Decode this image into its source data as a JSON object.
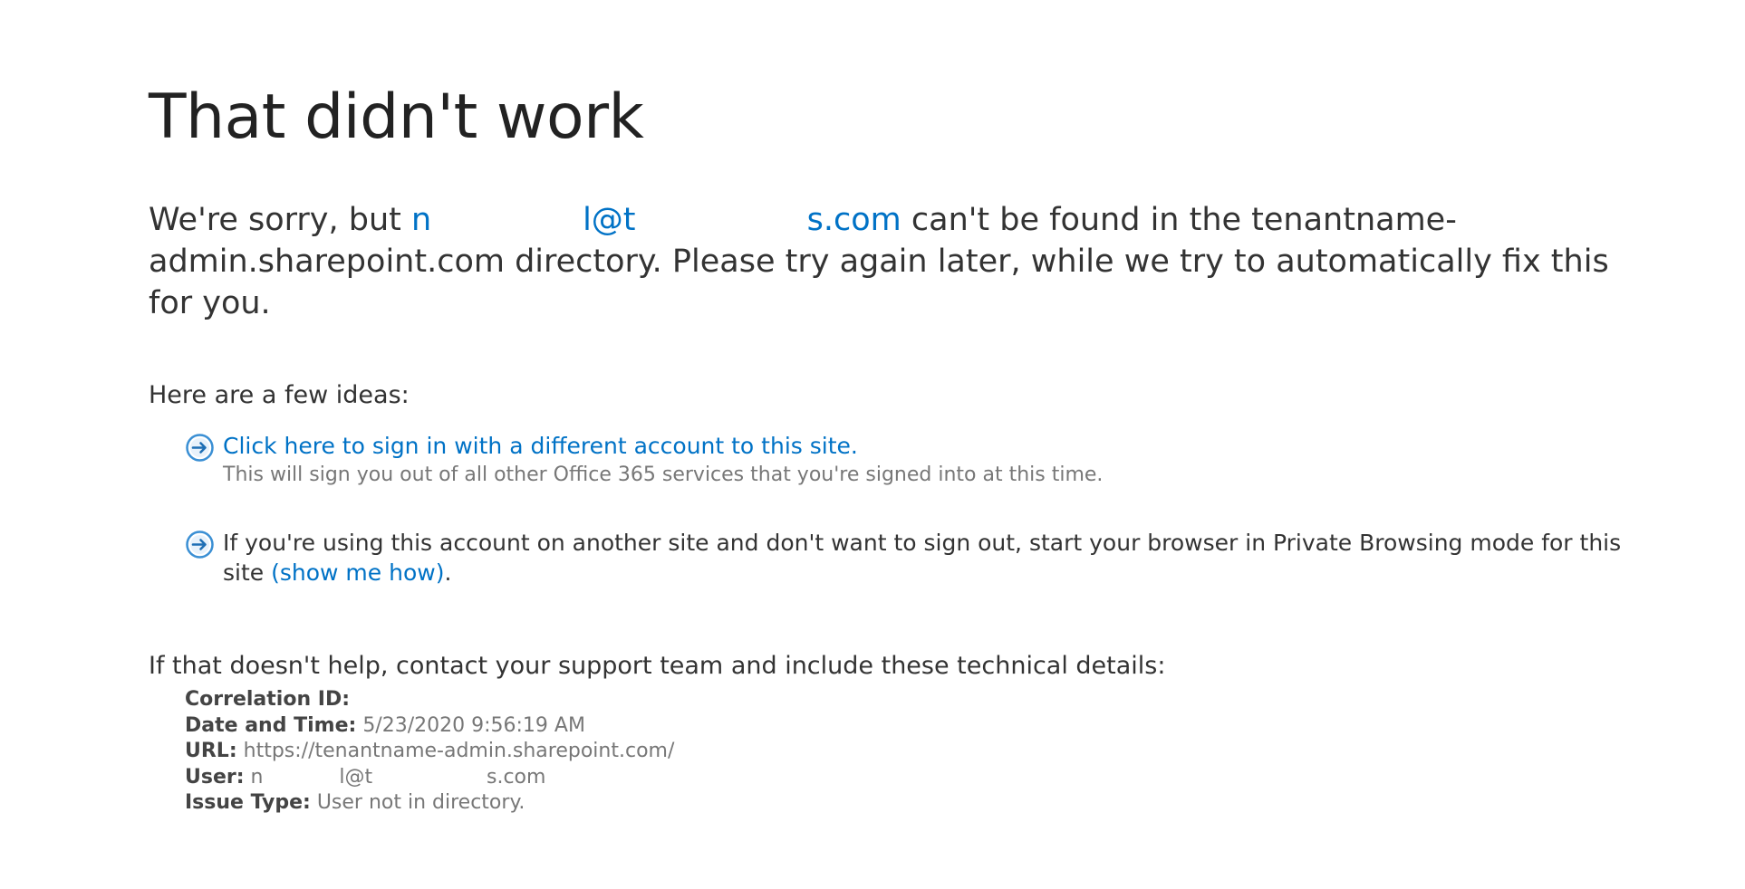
{
  "page": {
    "title": "That didn't work",
    "message": {
      "prefix": "We're sorry, but ",
      "email_display": "n               l@t                 s.com",
      "suffix": " can't be found in the tenantname-admin.sharepoint.com directory. Please try again later, while we try to automatically fix this for you."
    },
    "ideas_heading": "Here are a few ideas:",
    "ideas": [
      {
        "link_text": "Click here to sign in with a different account to this site.",
        "subtext": "This will sign you out of all other Office 365 services that you're signed into at this time.",
        "icon": "circle-arrow-right-icon"
      },
      {
        "text": "If you're using this account on another site and don't want to sign out, start your browser in Private Browsing mode for this site ",
        "link_text": "(show me how)",
        "trailing": ".",
        "icon": "circle-arrow-right-icon"
      }
    ],
    "help_text": "If that doesn't help, contact your support team and include these technical details:",
    "details": [
      {
        "label": "Correlation ID:",
        "value": ""
      },
      {
        "label": "Date and Time:",
        "value": "5/23/2020 9:56:19 AM"
      },
      {
        "label": "URL:",
        "value": "https://tenantname-admin.sharepoint.com/"
      },
      {
        "label": "User:",
        "value": "n            l@t                  s.com"
      },
      {
        "label": "Issue Type:",
        "value": "User not in directory."
      }
    ]
  },
  "colors": {
    "link": "#0072c6",
    "text": "#333333",
    "muted": "#777777",
    "title": "#222222"
  }
}
